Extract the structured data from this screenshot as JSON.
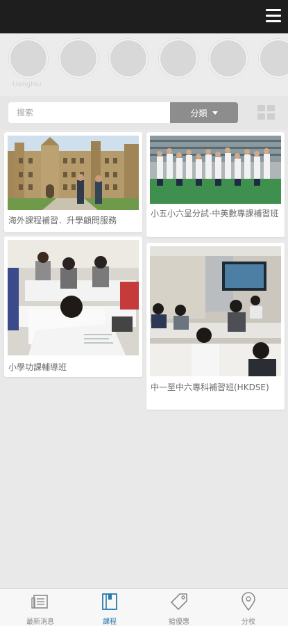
{
  "header": {
    "menu_icon": "hamburger-menu-icon"
  },
  "stories": {
    "count": 6,
    "first_label": "Uanghiu"
  },
  "search": {
    "placeholder": "搜索",
    "category_label": "分類",
    "view_icon": "grid-view-icon"
  },
  "courses": [
    {
      "title": "海外課程補習．升學顧問服務",
      "image": "university-campus-photo"
    },
    {
      "title": "小五小六呈分試-中英數專課補習班",
      "image": "students-on-field-photo"
    },
    {
      "title": "小學功課輔導班",
      "image": "children-studying-photo"
    },
    {
      "title": "中一至中六專科補習班(HKDSE)",
      "image": "secondary-classroom-photo"
    }
  ],
  "bottom_nav": {
    "items": [
      {
        "label": "最新消息",
        "icon": "news-icon"
      },
      {
        "label": "課程",
        "icon": "book-icon"
      },
      {
        "label": "搶優惠",
        "icon": "tag-icon"
      },
      {
        "label": "分校",
        "icon": "location-pin-icon"
      }
    ],
    "active_index": 1
  },
  "colors": {
    "topbar": "#1e1e1e",
    "accent": "#2a79a8",
    "inactive_icon": "#8a8a8a",
    "background": "#e9e9e9"
  }
}
